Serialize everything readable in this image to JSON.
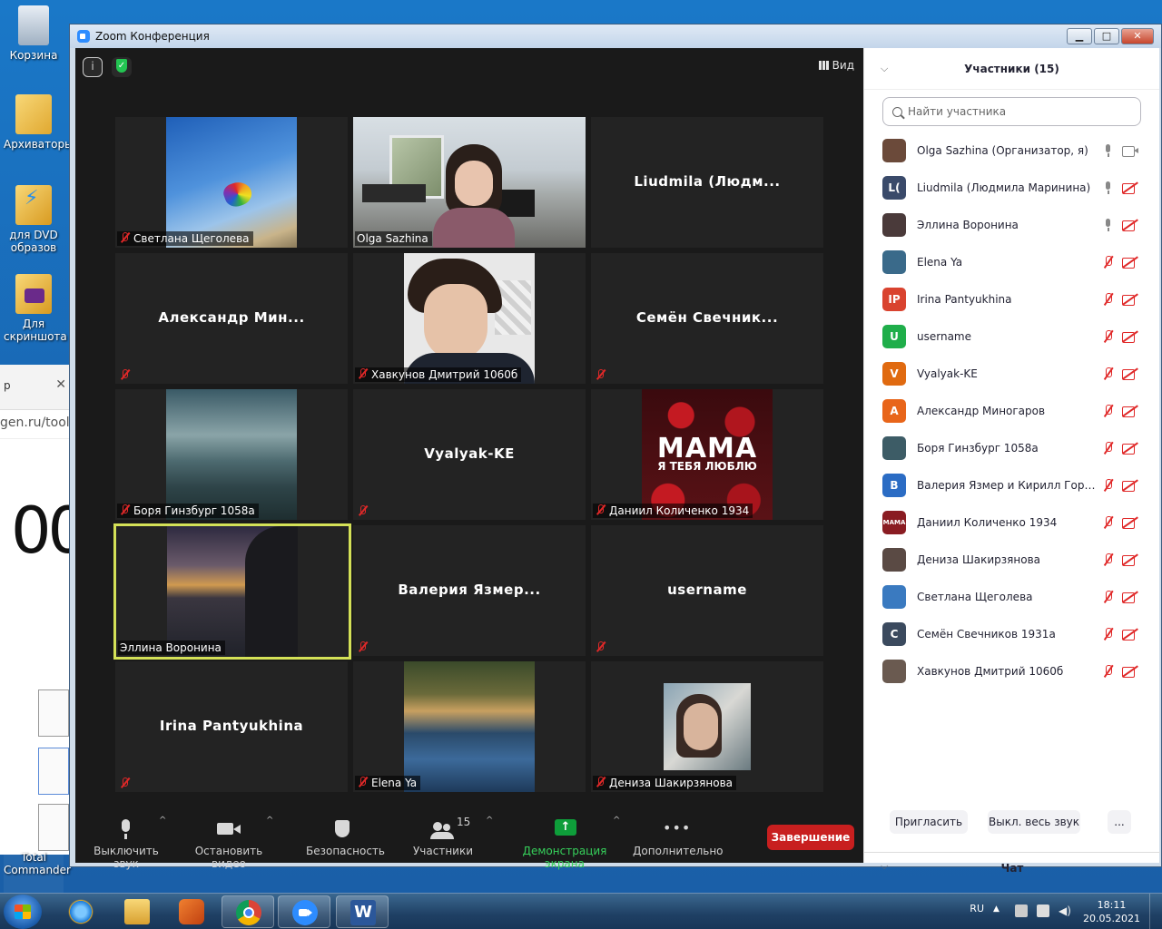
{
  "desktop": {
    "icons": [
      {
        "label": "Корзина"
      },
      {
        "label": "Архиваторы"
      },
      {
        "label": "для DVD образов"
      },
      {
        "label": "Для скриншота"
      },
      {
        "label": "Total Commander"
      }
    ]
  },
  "bg_browser": {
    "tab_text": "р",
    "close": "✕",
    "url": "gen.ru/tools/",
    "big_text": "00"
  },
  "window": {
    "title": "Zoom Конференция",
    "minimize": "▁",
    "maximize": "□",
    "close": "✕"
  },
  "meeting": {
    "view_label": "Вид",
    "info_icon": "i",
    "tiles": [
      {
        "name": "Светлана Щеголева",
        "video": true
      },
      {
        "name": "Olga Sazhina",
        "video": true
      },
      {
        "name": "Liudmila  (Людм..."
      },
      {
        "name": "Александр  Мин..."
      },
      {
        "name": "Хавкунов Дмитрий 1060б",
        "video": true
      },
      {
        "name": "Семён  Свечник..."
      },
      {
        "name": "Боря Гинзбург 1058а",
        "video": true
      },
      {
        "name": "Vyalyak-KE"
      },
      {
        "name": "Даниил Количенко 1934",
        "video": true,
        "poster_title": "МАМА",
        "poster_sub": "Я ТЕБЯ ЛЮБЛЮ"
      },
      {
        "name": "Эллина Воронина",
        "video": true,
        "active": true
      },
      {
        "name": "Валерия  Язмер..."
      },
      {
        "name": "username"
      },
      {
        "name": "Irina  Pantyukhina"
      },
      {
        "name": "Elena Ya",
        "video": true
      },
      {
        "name": "Дениза Шакирзянова",
        "video": true
      }
    ]
  },
  "controls": {
    "mute": "Выключить звук",
    "video": "Остановить видео",
    "security": "Безопасность",
    "participants": "Участники",
    "participants_count": "15",
    "share": "Демонстрация экрана",
    "more": "Дополнительно",
    "end": "Завершение"
  },
  "panel": {
    "title": "Участники (15)",
    "search_placeholder": "Найти участника",
    "participants": [
      {
        "name": "Olga Sazhina (Организатор, я)",
        "avatar": "",
        "color": "#6b4a3a",
        "mic": "on",
        "cam": "on"
      },
      {
        "name": "Liudmila (Людмила Маринина)",
        "avatar": "L(",
        "color": "#3a4a6a",
        "mic": "on",
        "cam": "off"
      },
      {
        "name": "Эллина Воронина",
        "avatar": "",
        "color": "#4a3a3a",
        "mic": "on",
        "cam": "off"
      },
      {
        "name": "Elena Ya",
        "avatar": "",
        "color": "#3a6a8a",
        "mic": "off",
        "cam": "off"
      },
      {
        "name": "Irina Pantyukhina",
        "avatar": "IP",
        "color": "#d9432f",
        "mic": "off",
        "cam": "off"
      },
      {
        "name": "username",
        "avatar": "U",
        "color": "#1fae4a",
        "mic": "off",
        "cam": "off"
      },
      {
        "name": "Vyalyak-KE",
        "avatar": "V",
        "color": "#e06a10",
        "mic": "off",
        "cam": "off"
      },
      {
        "name": "Александр Миногаров",
        "avatar": "А",
        "color": "#e8651a",
        "mic": "off",
        "cam": "off"
      },
      {
        "name": "Боря Гинзбург 1058а",
        "avatar": "",
        "color": "#3d5c66",
        "mic": "off",
        "cam": "off"
      },
      {
        "name": "Валерия Язмер и Кирилл Горш...",
        "avatar": "В",
        "color": "#2b6cc4",
        "mic": "off",
        "cam": "off"
      },
      {
        "name": "Даниил Количенко 1934",
        "avatar": "МАМА",
        "color": "#8a1c22",
        "mic": "off",
        "cam": "off"
      },
      {
        "name": "Дениза Шакирзянова",
        "avatar": "",
        "color": "#5a4a44",
        "mic": "off",
        "cam": "off"
      },
      {
        "name": "Светлана Щеголева",
        "avatar": "",
        "color": "#3a7ac0",
        "mic": "off",
        "cam": "off"
      },
      {
        "name": "Семён Свечников 1931а",
        "avatar": "С",
        "color": "#3b4a5e",
        "mic": "off",
        "cam": "off"
      },
      {
        "name": "Хавкунов Дмитрий 1060б",
        "avatar": "",
        "color": "#6a5a50",
        "mic": "off",
        "cam": "off"
      }
    ],
    "invite": "Пригласить",
    "mute_all": "Выкл. весь звук",
    "more": "...",
    "chat_title": "Чат"
  },
  "taskbar": {
    "lang": "RU",
    "time": "18:11",
    "date": "20.05.2021"
  }
}
